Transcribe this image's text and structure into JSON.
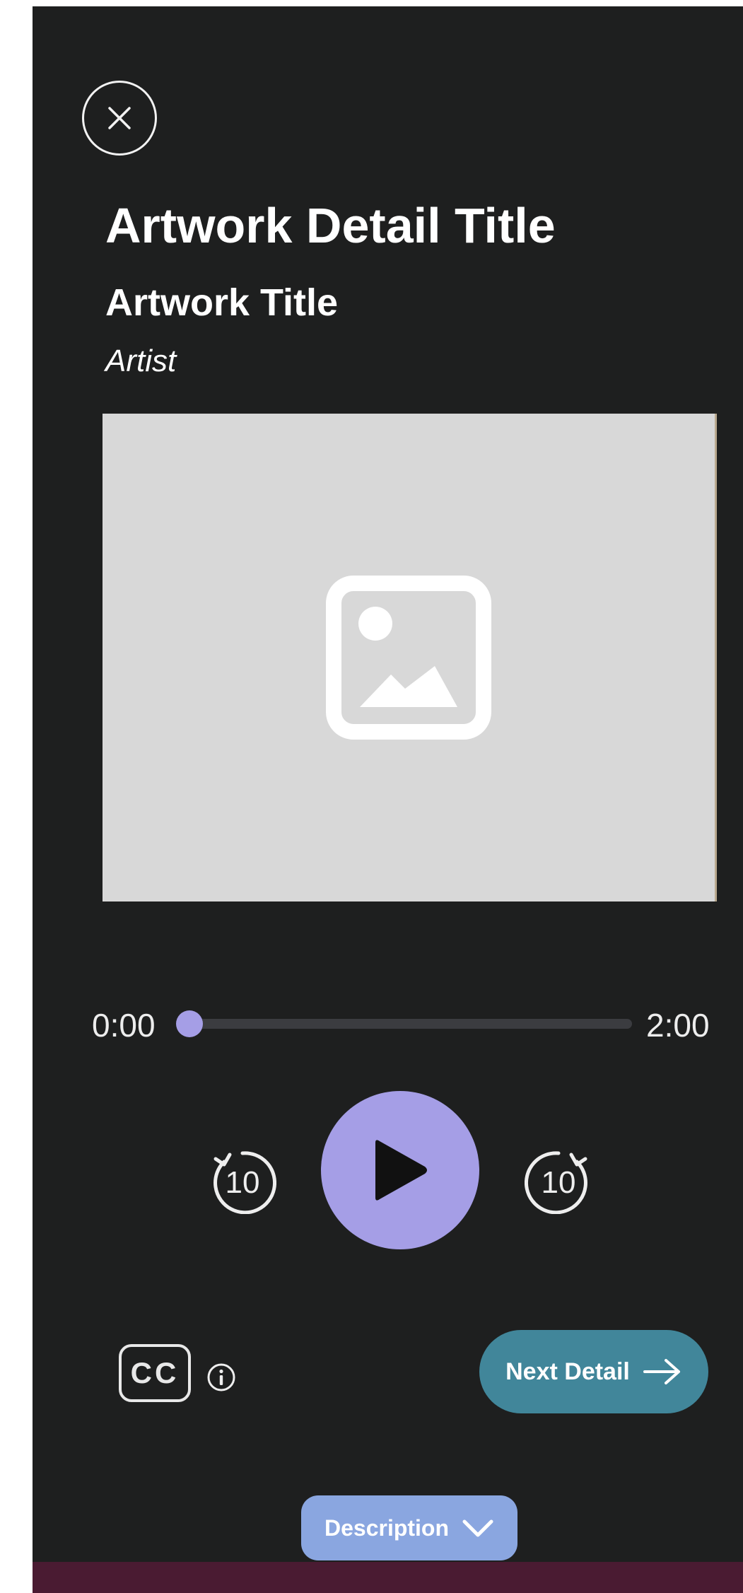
{
  "header": {
    "close_icon": "close-icon",
    "detail_title": "Artwork Detail Title",
    "artwork_title": "Artwork Title",
    "artist": "Artist"
  },
  "media": {
    "image_icon": "image-placeholder-icon"
  },
  "player": {
    "current_time": "0:00",
    "total_time": "2:00",
    "progress": 0,
    "skip_back_seconds": "10",
    "skip_forward_seconds": "10",
    "play_icon": "play-icon"
  },
  "controls": {
    "cc_label": "CC",
    "info_icon": "info-icon",
    "next_label": "Next Detail",
    "next_icon": "arrow-right-icon"
  },
  "footer": {
    "description_label": "Description",
    "description_icon": "chevron-down-icon"
  },
  "colors": {
    "panel_background": "#1e1f1f",
    "accent_purple": "#a59ee6",
    "next_button": "#41869a",
    "description_button": "#8aa6e0",
    "bottom_strip": "#4a1b32"
  }
}
